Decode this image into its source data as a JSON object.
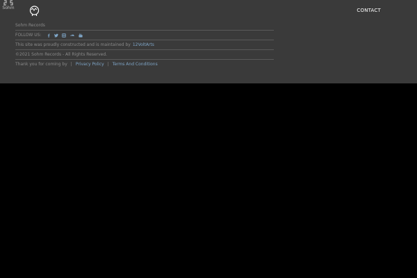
{
  "header": {
    "corner_logo_text": "Sohm",
    "nav_contact_label": "CONTACT"
  },
  "footer": {
    "site_name": "Sohm Records",
    "follow_label": "FOLLOW US:",
    "social_icons": [
      "facebook-icon",
      "twitter-icon",
      "instagram-icon",
      "soundcloud-icon",
      "youtube-icon"
    ],
    "constructed_text": "This site was proudly constructed and is maintained by",
    "constructed_link": "12VoltArts",
    "copyright_text": "©2021 Sohm Records - All Rights Reserved.",
    "thanks_text": "Thank you for coming by",
    "privacy_link": "Privacy Policy",
    "terms_link": "Terms And Conditions",
    "separator": "|"
  },
  "colors": {
    "panel_bg": "#3a3a3a",
    "page_bg": "#000000",
    "link": "#7fa6c8",
    "muted_text": "#8a8a8a"
  }
}
